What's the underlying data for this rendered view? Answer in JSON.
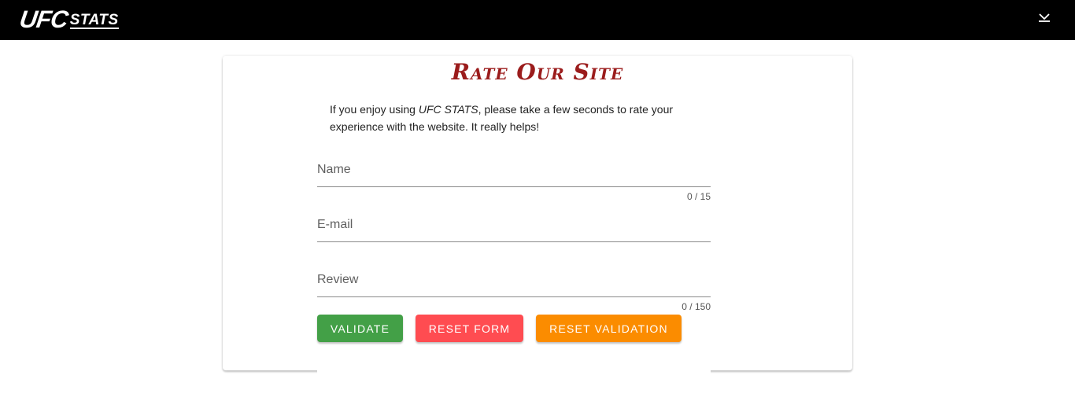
{
  "header": {
    "logo_ufc": "UFC",
    "logo_stats": "STATS",
    "menu_icon": "chevron-down-icon"
  },
  "card": {
    "title": "Rate Our Site",
    "intro_before": "If you enjoy using ",
    "intro_em": "UFC STATS",
    "intro_after": ", please take a few seconds to rate your experience with the website. It really helps!"
  },
  "form": {
    "name": {
      "label": "Name",
      "value": "",
      "counter": "0 / 15"
    },
    "email": {
      "label": "E-mail",
      "value": ""
    },
    "review": {
      "label": "Review",
      "value": "",
      "counter": "0 / 150"
    }
  },
  "buttons": {
    "validate": "Validate",
    "reset_form": "Reset Form",
    "reset_validation": "Reset Validation"
  },
  "colors": {
    "title": "#9b1c1c",
    "validate": "#43a047",
    "reset_form": "#ff4c51",
    "reset_validation": "#fb8c00"
  }
}
